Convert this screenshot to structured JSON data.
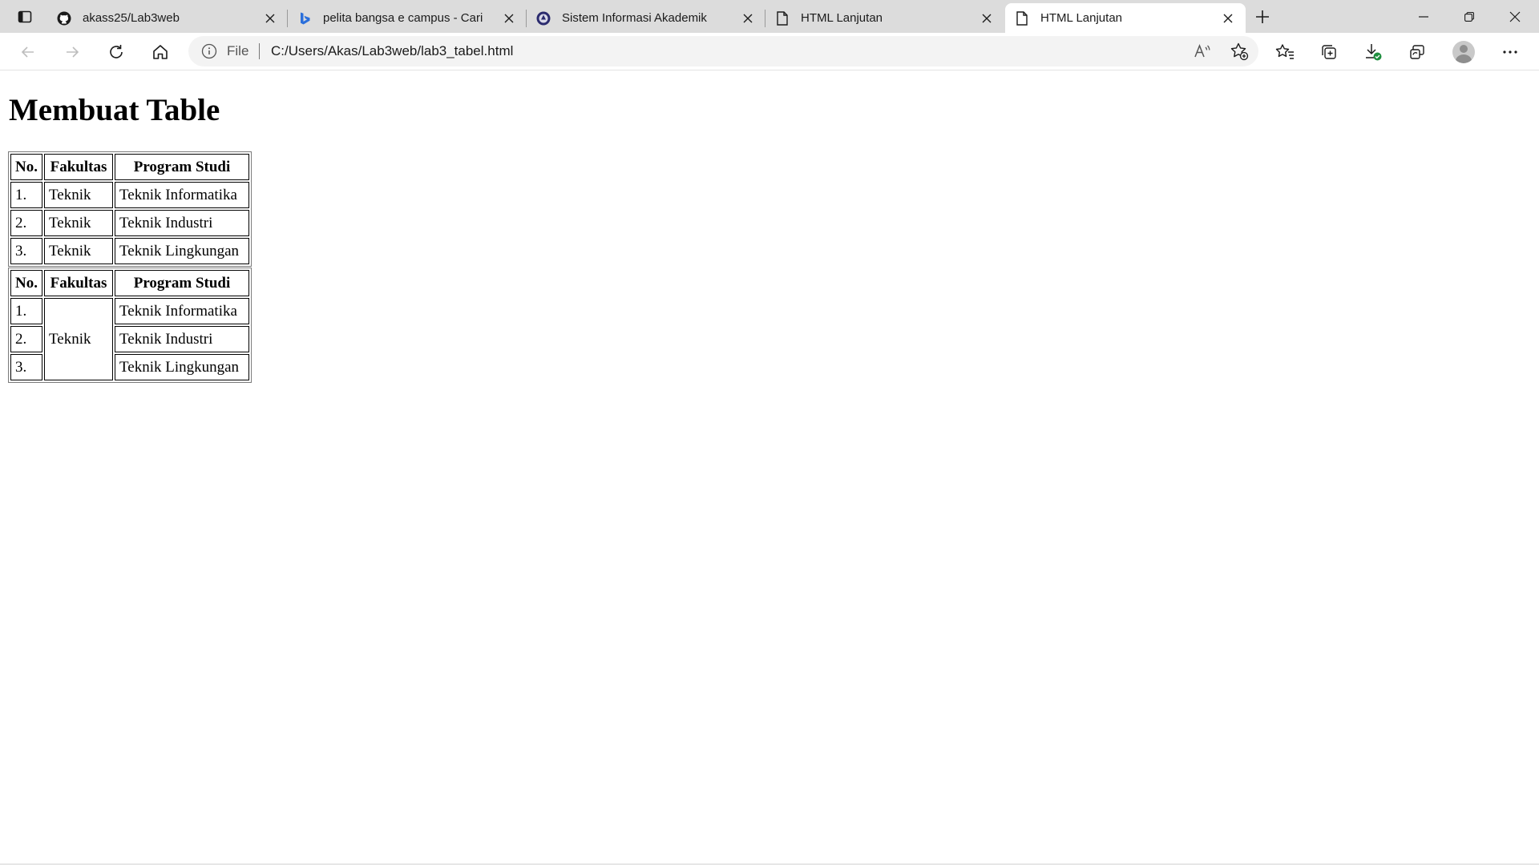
{
  "tabs": [
    {
      "title": "akass25/Lab3web",
      "icon": "github-icon",
      "active": false
    },
    {
      "title": "pelita bangsa e campus - Cari",
      "icon": "bing-icon",
      "active": false
    },
    {
      "title": "Sistem Informasi Akademik",
      "icon": "campus-logo-icon",
      "active": false
    },
    {
      "title": "HTML Lanjutan",
      "icon": "page-icon",
      "active": false
    },
    {
      "title": "HTML Lanjutan",
      "icon": "page-icon",
      "active": true
    }
  ],
  "address_bar": {
    "scheme_label": "File",
    "url": "C:/Users/Akas/Lab3web/lab3_tabel.html"
  },
  "page": {
    "heading": "Membuat Table",
    "table1": {
      "headers": [
        "No.",
        "Fakultas",
        "Program Studi"
      ],
      "rows": [
        [
          "1.",
          "Teknik",
          "Teknik Informatika"
        ],
        [
          "2.",
          "Teknik",
          "Teknik Industri"
        ],
        [
          "3.",
          "Teknik",
          "Teknik Lingkungan"
        ]
      ]
    },
    "table2": {
      "headers": [
        "No.",
        "Fakultas",
        "Program Studi"
      ],
      "merged_fakultas": "Teknik",
      "rows": [
        [
          "1.",
          "Teknik Informatika"
        ],
        [
          "2.",
          "Teknik Industri"
        ],
        [
          "3.",
          "Teknik Lingkungan"
        ]
      ]
    }
  },
  "colors": {
    "tabstrip_bg": "#dcdcdc",
    "active_tab_bg": "#ffffff",
    "omnibox_bg": "#f3f3f3",
    "download_badge": "#1e8e3e"
  }
}
